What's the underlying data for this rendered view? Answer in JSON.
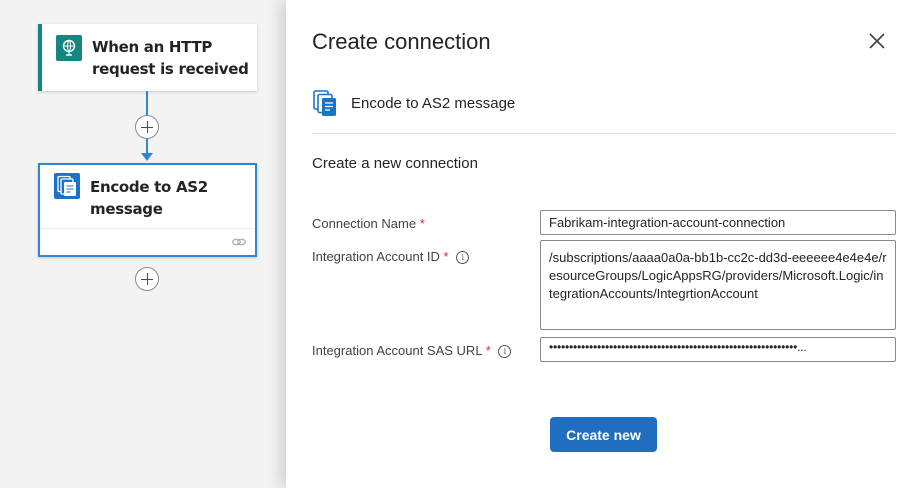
{
  "canvas": {
    "trigger_title": "When an HTTP request is received",
    "action_title": "Encode to AS2 message"
  },
  "panel": {
    "title": "Create connection",
    "connector_name": "Encode to AS2 message",
    "section_title": "Create a new connection",
    "fields": {
      "connection_name_label": "Connection Name",
      "connection_name_value": "Fabrikam-integration-account-connection",
      "integration_account_id_label": "Integration Account ID",
      "integration_account_id_value": "/subscriptions/aaaa0a0a-bb1b-cc2c-dd3d-eeeeee4e4e4e/resourceGroups/LogicAppsRG/providers/Microsoft.Logic/integrationAccounts/IntegrtionAccount",
      "sas_url_label": "Integration Account SAS URL",
      "sas_url_value": "••••••••••••••••••••••••••••••••••••••••••••••••••••••••••••••...",
      "required_mark": "*",
      "info_mark": "i"
    },
    "create_button": "Create new"
  },
  "colors": {
    "trigger_accent": "#12867f",
    "action_accent": "#1a73c9",
    "connector_line": "#2f86d6",
    "primary_button": "#1f6ebf",
    "required": "#c4314b"
  },
  "icons": {
    "trigger": "http-request-icon",
    "action": "as2-encode-icon",
    "close": "close-icon",
    "add_step": "plus-icon",
    "link": "link-icon",
    "info": "info-icon"
  }
}
